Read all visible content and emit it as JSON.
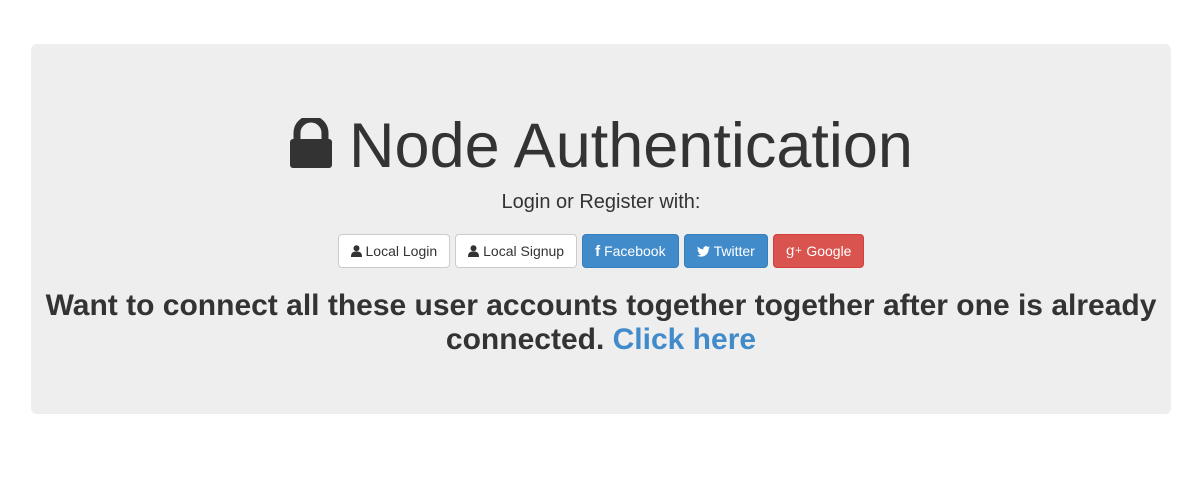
{
  "header": {
    "icon": "lock-icon",
    "title": "Node Authentication",
    "subtitle": "Login or Register with:"
  },
  "buttons": [
    {
      "label": "Local Login",
      "icon": "user-icon",
      "style": "default"
    },
    {
      "label": "Local Signup",
      "icon": "user-icon",
      "style": "default"
    },
    {
      "label": "Facebook",
      "icon": "facebook-icon",
      "style": "primary"
    },
    {
      "label": "Twitter",
      "icon": "twitter-icon",
      "style": "info"
    },
    {
      "label": "Google",
      "icon": "google-plus-icon",
      "style": "danger"
    }
  ],
  "message": {
    "text": "Want to connect all these user accounts together together after one is already connected.",
    "link": "Click here"
  },
  "colors": {
    "panel_bg": "#eeeeee",
    "primary": "#428bca",
    "danger": "#d9534f",
    "text": "#333333"
  }
}
